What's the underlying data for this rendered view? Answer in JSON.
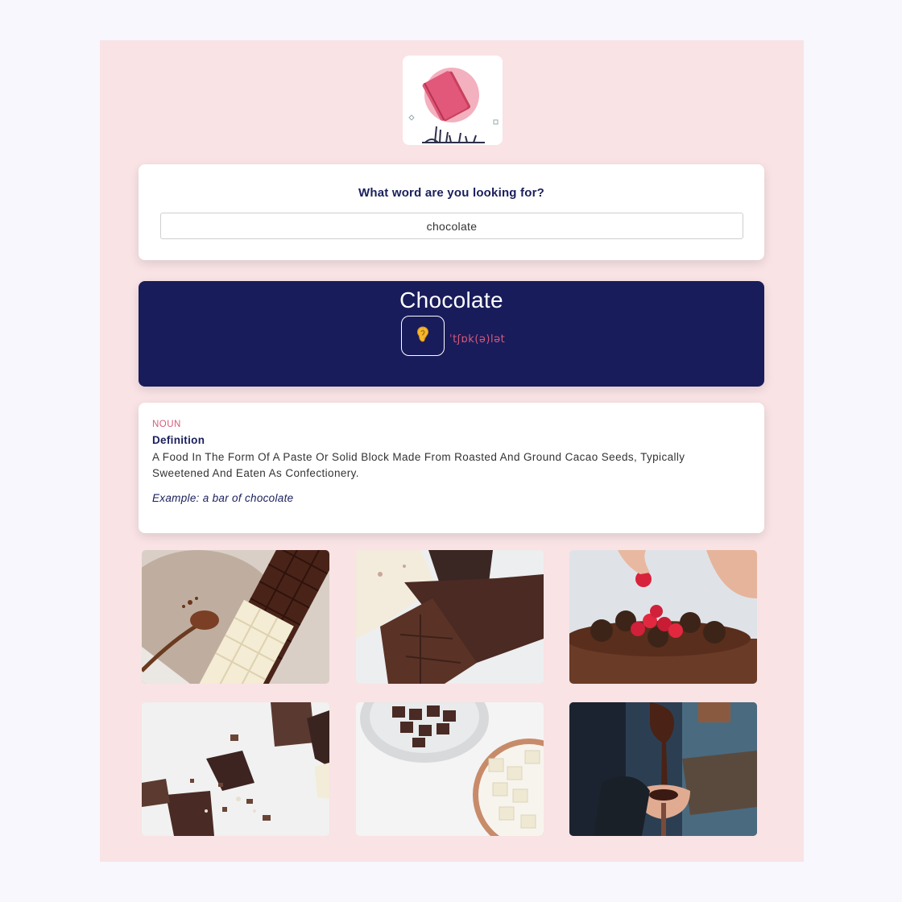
{
  "search": {
    "prompt": "What word are you looking for?",
    "value": "chocolate"
  },
  "word": {
    "title": "Chocolate",
    "phonetic": "ˈtʃɒk(ə)lət",
    "audio_icon": "ear-icon"
  },
  "meaning": {
    "part_of_speech": "NOUN",
    "definition_label": "Definition",
    "definition": "A Food In The Form Of A Paste Or Solid Block Made From Roasted And Ground Cacao Seeds, Typically Sweetened And Eaten As Confectionery.",
    "example": "Example: a bar of chocolate"
  },
  "colors": {
    "page_bg": "#f7f7fd",
    "app_bg": "#f9e3e5",
    "navy": "#191c5b",
    "accent_pink": "#d75a78"
  }
}
